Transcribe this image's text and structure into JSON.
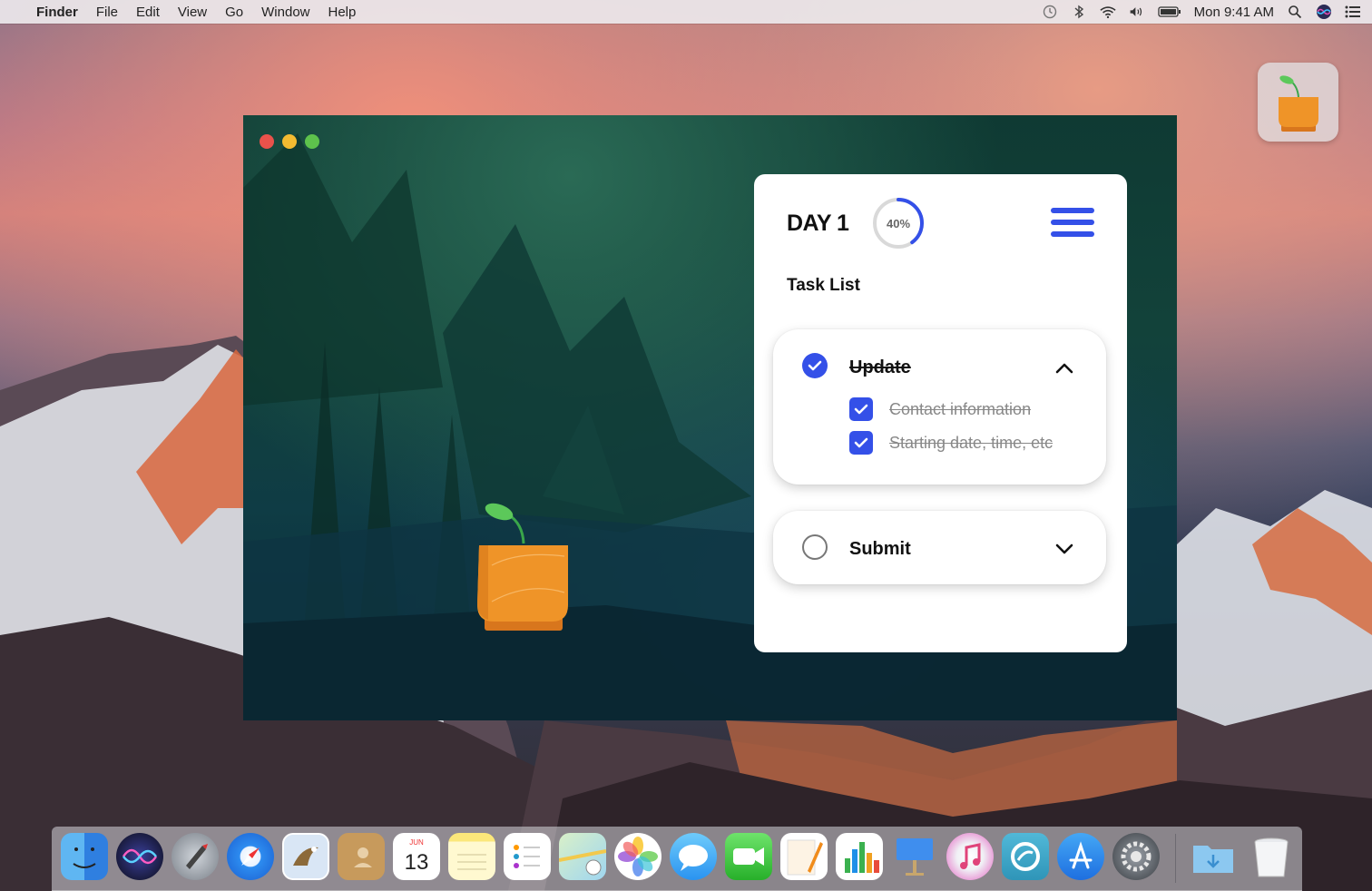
{
  "menubar": {
    "app_name": "Finder",
    "menus": [
      "File",
      "Edit",
      "View",
      "Go",
      "Window",
      "Help"
    ],
    "clock": "Mon 9:41 AM",
    "status_icons": [
      "time-machine-icon",
      "bluetooth-icon",
      "wifi-icon",
      "volume-icon",
      "battery-icon",
      "spotlight-icon",
      "siri-icon",
      "notification-center-icon"
    ]
  },
  "window": {
    "traffic_lights": [
      "close",
      "minimize",
      "zoom"
    ]
  },
  "panel": {
    "day_label": "DAY 1",
    "progress_label": "40%",
    "progress_value": 0.4,
    "section_title": "Task List",
    "accent_color": "#3450e8",
    "tasks": [
      {
        "title": "Update",
        "done": true,
        "expanded": true,
        "subtasks": [
          {
            "label": "Contact information",
            "done": true
          },
          {
            "label": "Starting date, time, etc",
            "done": true
          }
        ]
      },
      {
        "title": "Submit",
        "done": false,
        "expanded": false,
        "subtasks": []
      }
    ]
  },
  "calendar_icon": {
    "month": "JUN",
    "day": "13"
  },
  "dock": {
    "items": [
      "finder",
      "siri",
      "launchpad",
      "safari",
      "mail",
      "contacts",
      "calendar",
      "notes",
      "reminders",
      "maps",
      "photos",
      "messages",
      "facetime",
      "pages",
      "numbers",
      "keynote",
      "itunes",
      "plant-app",
      "app-store",
      "system-preferences",
      "downloads",
      "trash"
    ]
  }
}
